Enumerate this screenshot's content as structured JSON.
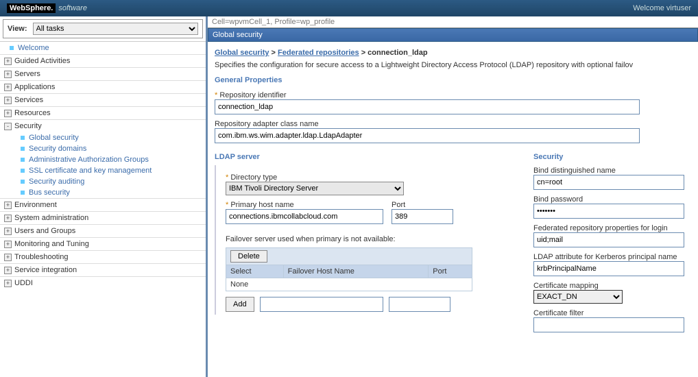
{
  "header": {
    "brand_bold": "WebSphere.",
    "brand_light": "software",
    "welcome": "Welcome virtuser"
  },
  "sidebar": {
    "view_label": "View:",
    "view_value": "All tasks",
    "welcome": "Welcome",
    "nodes": [
      "Guided Activities",
      "Servers",
      "Applications",
      "Services",
      "Resources",
      "Security",
      "Environment",
      "System administration",
      "Users and Groups",
      "Monitoring and Tuning",
      "Troubleshooting",
      "Service integration",
      "UDDI"
    ],
    "security_children": [
      "Global security",
      "Security domains",
      "Administrative Authorization Groups",
      "SSL certificate and key management",
      "Security auditing",
      "Bus security"
    ]
  },
  "content": {
    "cell_info": "Cell=wpvmCell_1, Profile=wp_profile",
    "title_bar": "Global security",
    "breadcrumb": {
      "a": "Global security",
      "b": "Federated repositories",
      "c": "connection_ldap"
    },
    "description": "Specifies the configuration for secure access to a Lightweight Directory Access Protocol (LDAP) repository with optional failov",
    "general_title": "General Properties",
    "repo_id_label": "Repository identifier",
    "repo_id_value": "connection_ldap",
    "adapter_label": "Repository adapter class name",
    "adapter_value": "com.ibm.ws.wim.adapter.ldap.LdapAdapter",
    "ldap": {
      "title": "LDAP server",
      "dir_type_label": "Directory type",
      "dir_type_value": "IBM Tivoli Directory Server",
      "host_label": "Primary host name",
      "host_value": "connections.ibmcollabcloud.com",
      "port_label": "Port",
      "port_value": "389",
      "failover_label": "Failover server used when primary is not available:",
      "delete_btn": "Delete",
      "col_select": "Select",
      "col_host": "Failover Host Name",
      "col_port": "Port",
      "none": "None",
      "add_btn": "Add"
    },
    "security": {
      "title": "Security",
      "bind_dn_label": "Bind distinguished name",
      "bind_dn_value": "cn=root",
      "bind_pw_label": "Bind password",
      "bind_pw_value": "•••••••",
      "fed_label": "Federated repository properties for login",
      "fed_value": "uid;mail",
      "krb_label": "LDAP attribute for Kerberos principal name",
      "krb_value": "krbPrincipalName",
      "certmap_label": "Certificate mapping",
      "certmap_value": "EXACT_DN",
      "certfilter_label": "Certificate filter"
    }
  }
}
